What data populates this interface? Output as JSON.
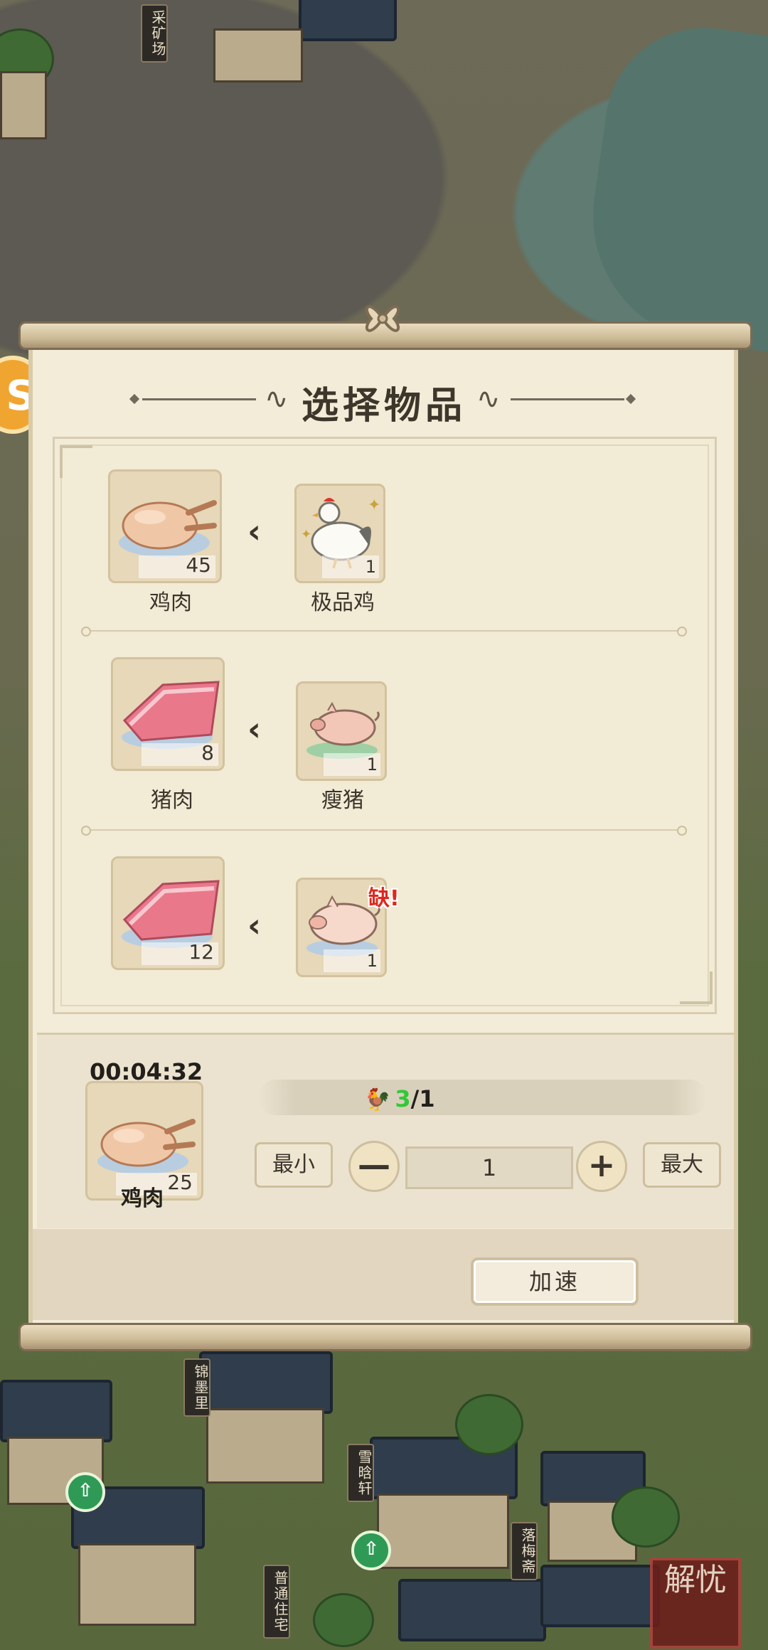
{
  "map": {
    "signs": [
      "采矿场",
      "锦墨里",
      "雪晗轩",
      "落梅斋",
      "普通住宅"
    ],
    "seal_text": "解忧"
  },
  "dialog": {
    "title": "选择物品",
    "recipes": [
      {
        "output_name": "鸡肉",
        "output_count": "45",
        "input_name": "极品鸡",
        "input_count": "1",
        "missing": ""
      },
      {
        "output_name": "猪肉",
        "output_count": "8",
        "input_name": "瘦猪",
        "input_count": "1",
        "missing": ""
      },
      {
        "output_name": "",
        "output_count": "12",
        "input_name": "",
        "input_count": "1",
        "missing": "缺!"
      }
    ],
    "production": {
      "timer": "00:04:32",
      "current_item": "鸡肉",
      "current_count": "25",
      "progress_have": "3",
      "progress_need": "/1",
      "min_label": "最小",
      "max_label": "最大",
      "minus_label": "—",
      "plus_label": "+",
      "quantity": "1",
      "speedup_label": "加速"
    }
  }
}
